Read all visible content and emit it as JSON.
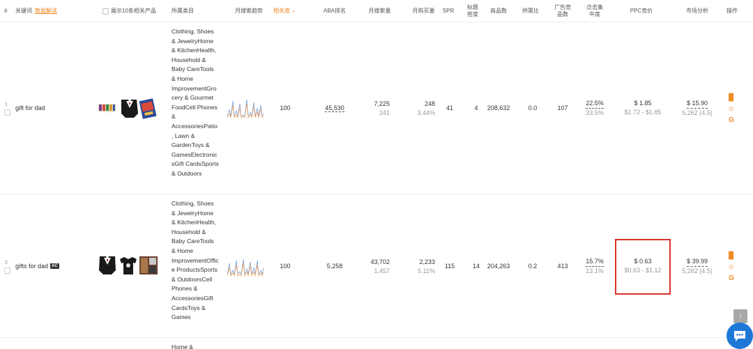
{
  "header": {
    "index": "#",
    "keyword": "关键词",
    "data_link": "数据解读",
    "show_products": "展示10条相关产品",
    "category": "所属类目",
    "trend": "月搜索趋势",
    "relevance": "相关度",
    "aba_rank": "ABA排名",
    "monthly_search": "月搜索量",
    "monthly_purchase": "月购买量",
    "spr": "SPR",
    "title_density": "标题密度",
    "products": "商品数",
    "supply_demand": "供需比",
    "ad_products": "广告竞品数",
    "click_concentration": "点击集中度",
    "ppc": "PPC竞价",
    "market": "市场分析",
    "action": "操作"
  },
  "rows": [
    {
      "index": "1",
      "keyword": "gift for dad",
      "ac": "",
      "category": "Clothing, Shoes & JewelryHome & KitchenHealth, Household & Baby CareTools & Home ImprovementGrocery & Gourmet FoodCell Phones & AccessoriesPatio, Lawn & GardenToys & GamesElectronicsGift CardsSports & Outdoors",
      "relevance": "100",
      "aba_rank": "45,530",
      "monthly_search": "7,225",
      "monthly_search_sub": "241",
      "monthly_purchase": "248",
      "monthly_purchase_sub": "3.44%",
      "spr": "41",
      "title_density": "4",
      "products": "208,632",
      "supply_demand": "0.0",
      "ad_products": "107",
      "click_concentration": "22.5%",
      "click_concentration_sub": "33.5%",
      "ppc": "$ 1.85",
      "ppc_range": "$1.72 - $1.85",
      "market_price": "$ 15.90",
      "market_rating": "5,262 (4.5)"
    },
    {
      "index": "2",
      "keyword": "gifts for dad",
      "ac": "AC",
      "category": "Clothing, Shoes & JewelryHome & KitchenHealth, Household & Baby CareTools & Home ImprovementOffice ProductsSports & OutdoorsCell Phones & AccessoriesGift CardsToys & Games",
      "relevance": "100",
      "aba_rank": "5,258",
      "monthly_search": "43,702",
      "monthly_search_sub": "1,457",
      "monthly_purchase": "2,233",
      "monthly_purchase_sub": "5.11%",
      "spr": "115",
      "title_density": "14",
      "products": "204,263",
      "supply_demand": "0.2",
      "ad_products": "413",
      "click_concentration": "15.7%",
      "click_concentration_sub": "13.1%",
      "ppc": "$ 0.63",
      "ppc_range": "$0.63 - $1.12",
      "market_price": "$ 39.99",
      "market_rating": "5,262 (4.5)"
    },
    {
      "category_peek": "Home &"
    }
  ],
  "icons": {
    "chart": "bar-chart-icon",
    "face": "smiley-icon",
    "google": "google-icon",
    "scroll_top": "arrow-up-icon",
    "chat": "chat-bubble-icon"
  },
  "colors": {
    "accent": "#f08a24",
    "highlight": "#d9302b",
    "chat": "#1e78d8",
    "spark_blue": "#7a9fd6",
    "spark_orange": "#f3a96a"
  }
}
